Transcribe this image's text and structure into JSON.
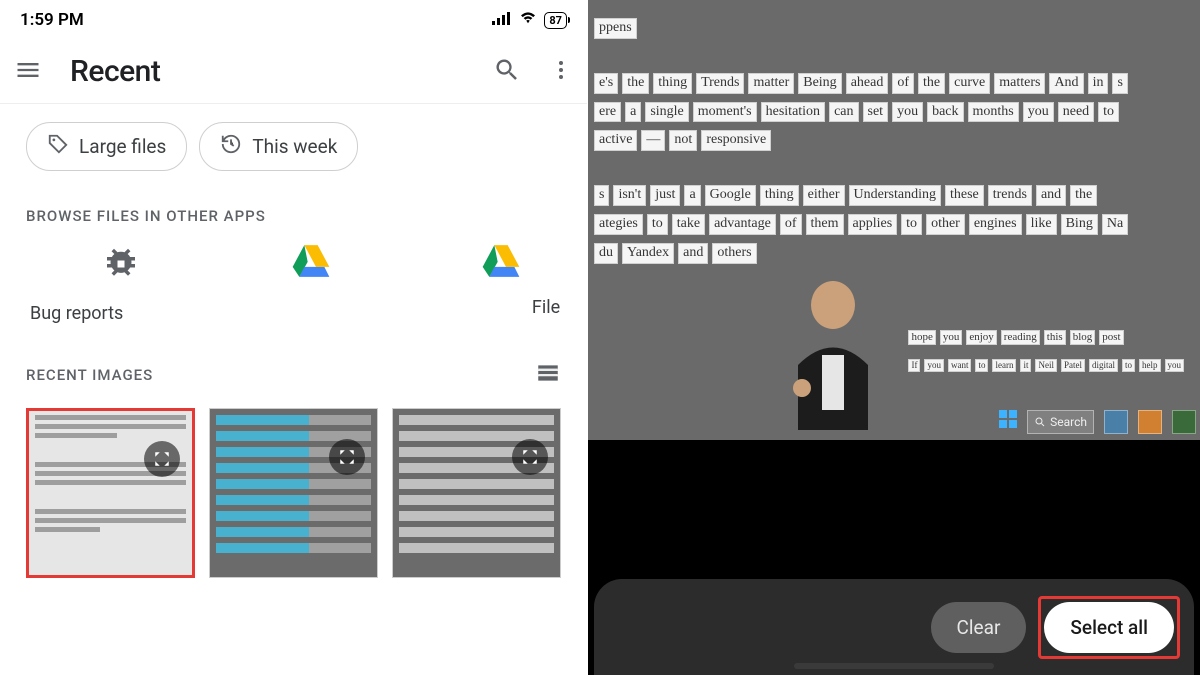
{
  "status": {
    "time": "1:59 PM",
    "battery": "87"
  },
  "header": {
    "title": "Recent"
  },
  "chips": {
    "large_files": "Large files",
    "this_week": "This week"
  },
  "browse_label": "BROWSE FILES IN OTHER APPS",
  "apps": {
    "bug": "Bug reports",
    "file": "File"
  },
  "recent_label": "RECENT IMAGES",
  "ocr": {
    "line0": [
      "ppens"
    ],
    "line1": [
      "e's",
      "the",
      "thing",
      "Trends",
      "matter",
      "Being",
      "ahead",
      "of",
      "the",
      "curve",
      "matters",
      "And",
      "in",
      "s"
    ],
    "line2": [
      "ere",
      "a",
      "single",
      "moment's",
      "hesitation",
      "can",
      "set",
      "you",
      "back",
      "months",
      "you",
      "need",
      "to"
    ],
    "line3": [
      "active",
      "—",
      "not",
      "responsive"
    ],
    "line4": [
      "s",
      "isn't",
      "just",
      "a",
      "Google",
      "thing",
      "either",
      "Understanding",
      "these",
      "trends",
      "and",
      "the"
    ],
    "line5": [
      "ategies",
      "to",
      "take",
      "advantage",
      "of",
      "them",
      "applies",
      "to",
      "other",
      "engines",
      "like",
      "Bing",
      "Na"
    ],
    "line6": [
      "du",
      "Yandex",
      "and",
      "others"
    ],
    "right1": [
      "hope",
      "you",
      "enjoy",
      "reading",
      "this",
      "blog",
      "post"
    ],
    "right2": [
      "If",
      "you",
      "want",
      "to",
      "learn",
      "it",
      "Neil",
      "Patel",
      "digital",
      "to",
      "help",
      "you"
    ],
    "search": "Search"
  },
  "actions": {
    "clear": "Clear",
    "select_all": "Select all"
  }
}
